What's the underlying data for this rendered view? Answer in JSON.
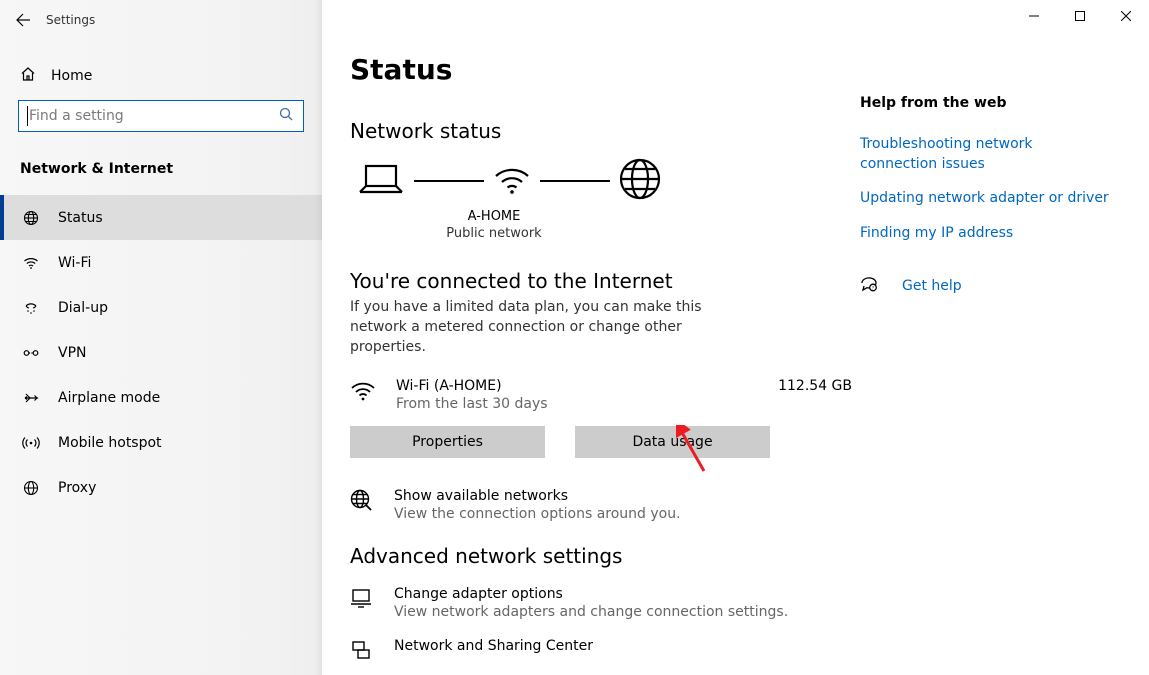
{
  "app_title": "Settings",
  "home_label": "Home",
  "search": {
    "placeholder": "Find a setting"
  },
  "section_label": "Network & Internet",
  "nav": {
    "status": {
      "label": "Status"
    },
    "wifi": {
      "label": "Wi-Fi"
    },
    "dialup": {
      "label": "Dial-up"
    },
    "vpn": {
      "label": "VPN"
    },
    "airplane": {
      "label": "Airplane mode"
    },
    "hotspot": {
      "label": "Mobile hotspot"
    },
    "proxy": {
      "label": "Proxy"
    }
  },
  "page": {
    "title": "Status",
    "network_status_heading": "Network status",
    "diagram": {
      "ssid": "A-HOME",
      "net_type": "Public network"
    },
    "connected_heading": "You're connected to the Internet",
    "connected_desc": "If you have a limited data plan, you can make this network a metered connection or change other properties.",
    "usage": {
      "adapter": "Wi-Fi (A-HOME)",
      "from": "From the last 30 days",
      "amount": "112.54 GB"
    },
    "properties_btn": "Properties",
    "data_usage_btn": "Data usage",
    "available": {
      "title": "Show available networks",
      "sub": "View the connection options around you."
    },
    "advanced_heading": "Advanced network settings",
    "adapter_opts": {
      "title": "Change adapter options",
      "sub": "View network adapters and change connection settings."
    },
    "sharing_center": {
      "title": "Network and Sharing Center"
    }
  },
  "help": {
    "heading": "Help from the web",
    "link1": "Troubleshooting network connection issues",
    "link2": "Updating network adapter or driver",
    "link3": "Finding my IP address",
    "get_help": "Get help"
  }
}
